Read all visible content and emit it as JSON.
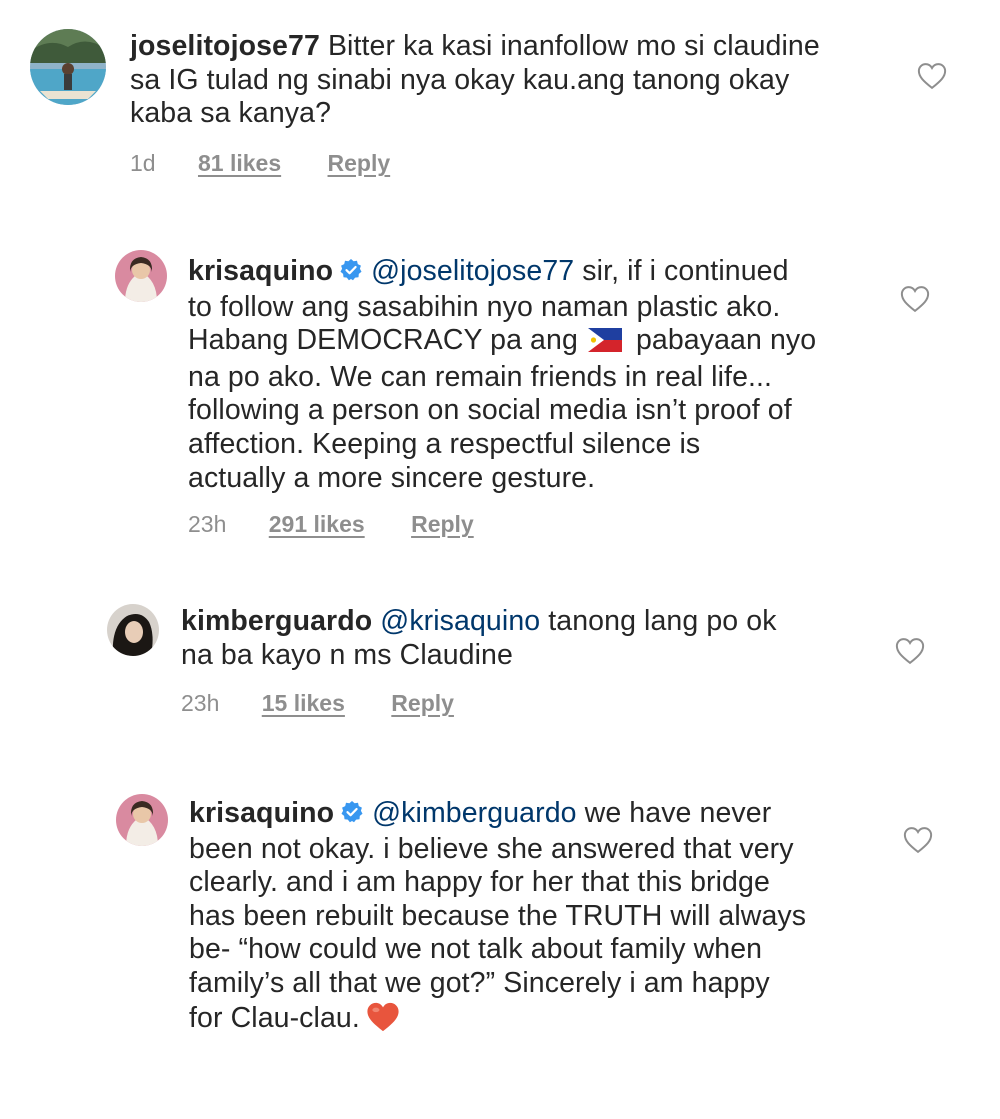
{
  "comments": [
    {
      "username": "joselitojose77",
      "verified": false,
      "lines": [
        [
          "Bitter ka kasi inanfollow mo si claudine"
        ],
        [
          "sa IG tulad ng sinabi nya okay kau.ang tanong okay"
        ],
        [
          "kaba sa kanya?"
        ]
      ],
      "time": "1d",
      "likes": "81 likes",
      "reply": "Reply"
    },
    {
      "username": "krisaquino",
      "verified": true,
      "mention": "@joselitojose77",
      "first_line_rest": "sir, if i continued",
      "lines": [
        "to follow ang sasabihin nyo naman plastic ako.",
        "pabayaan nyo",
        "na po ako. We can remain friends in real life...",
        "following a person on social media isn’t proof of",
        "affection. Keeping a respectful silence is",
        "actually a more sincere gesture."
      ],
      "line3_start": "Habang DEMOCRACY pa ang",
      "time": "23h",
      "likes": "291 likes",
      "reply": "Reply"
    },
    {
      "username": "kimberguardo",
      "verified": false,
      "mention": "@krisaquino",
      "first_line_rest": "tanong lang po ok",
      "lines": [
        "na ba kayo n ms Claudine"
      ],
      "time": "23h",
      "likes": "15 likes",
      "reply": "Reply"
    },
    {
      "username": "krisaquino",
      "verified": true,
      "mention": "@kimberguardo",
      "first_line_rest": "we have never",
      "lines": [
        "been not okay. i believe she answered that very",
        "clearly. and i am happy for her that this bridge",
        "has been rebuilt because the TRUTH will always",
        "be- “how could we not talk about family when",
        "family’s all that we got?” Sincerely i am happy",
        "for Clau-clau."
      ]
    }
  ],
  "colors": {
    "text": "#262626",
    "meta": "#8e8e8e",
    "verified_badge": "#3897f0",
    "heart_emoji": "#e8553d"
  },
  "icons": {
    "like": "heart-outline-icon",
    "verified": "verified-badge-icon",
    "flag": "philippines-flag-emoji",
    "heart_emoji": "red-heart-emoji"
  }
}
